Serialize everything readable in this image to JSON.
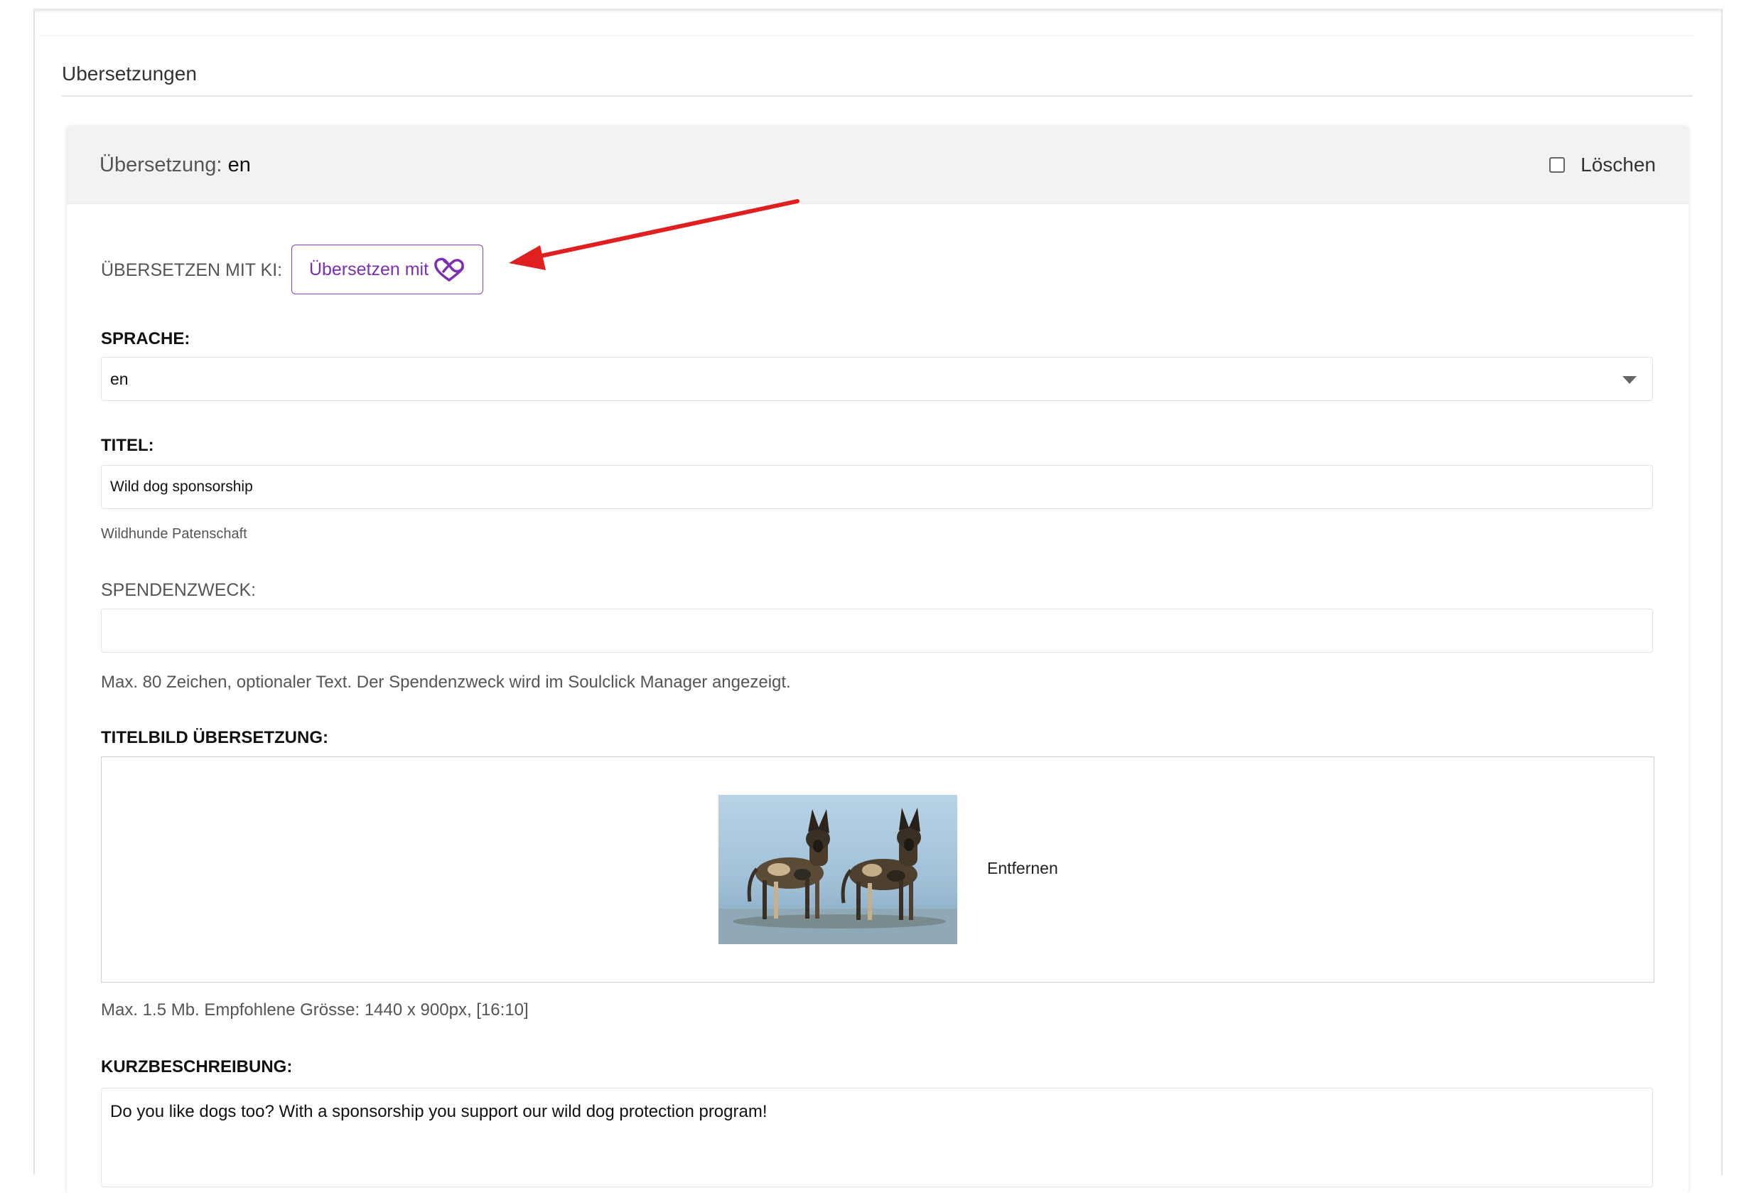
{
  "section": {
    "title": "Ubersetzungen"
  },
  "translation": {
    "header_label": "Übersetzung:",
    "header_value": "en",
    "delete_label": "Löschen"
  },
  "ai": {
    "label": "ÜBERSETZEN MIT KI:",
    "button_label": "Übersetzen mit",
    "button_icon": "infinity-heart-icon",
    "accent_color": "#7b2fb5"
  },
  "language": {
    "label": "SPRACHE:",
    "selected": "en"
  },
  "title_field": {
    "label": "TITEL:",
    "value": "Wild dog sponsorship",
    "original_hint": "Wildhunde Patenschaft"
  },
  "purpose_field": {
    "label": "SPENDENZWECK:",
    "value": "",
    "help": "Max. 80 Zeichen, optionaler Text. Der Spendenzweck wird im Soulclick Manager angezeigt."
  },
  "title_image": {
    "label": "TITELBILD ÜBERSETZUNG:",
    "remove_label": "Entfernen",
    "help": "Max. 1.5 Mb. Empfohlene Grösse: 1440 x 900px, [16:10]"
  },
  "short_description": {
    "label": "KURZBESCHREIBUNG:",
    "value": "Do you like dogs too? With a sponsorship you support our wild dog protection program!"
  },
  "annotation": {
    "arrow_color": "#e02020"
  }
}
